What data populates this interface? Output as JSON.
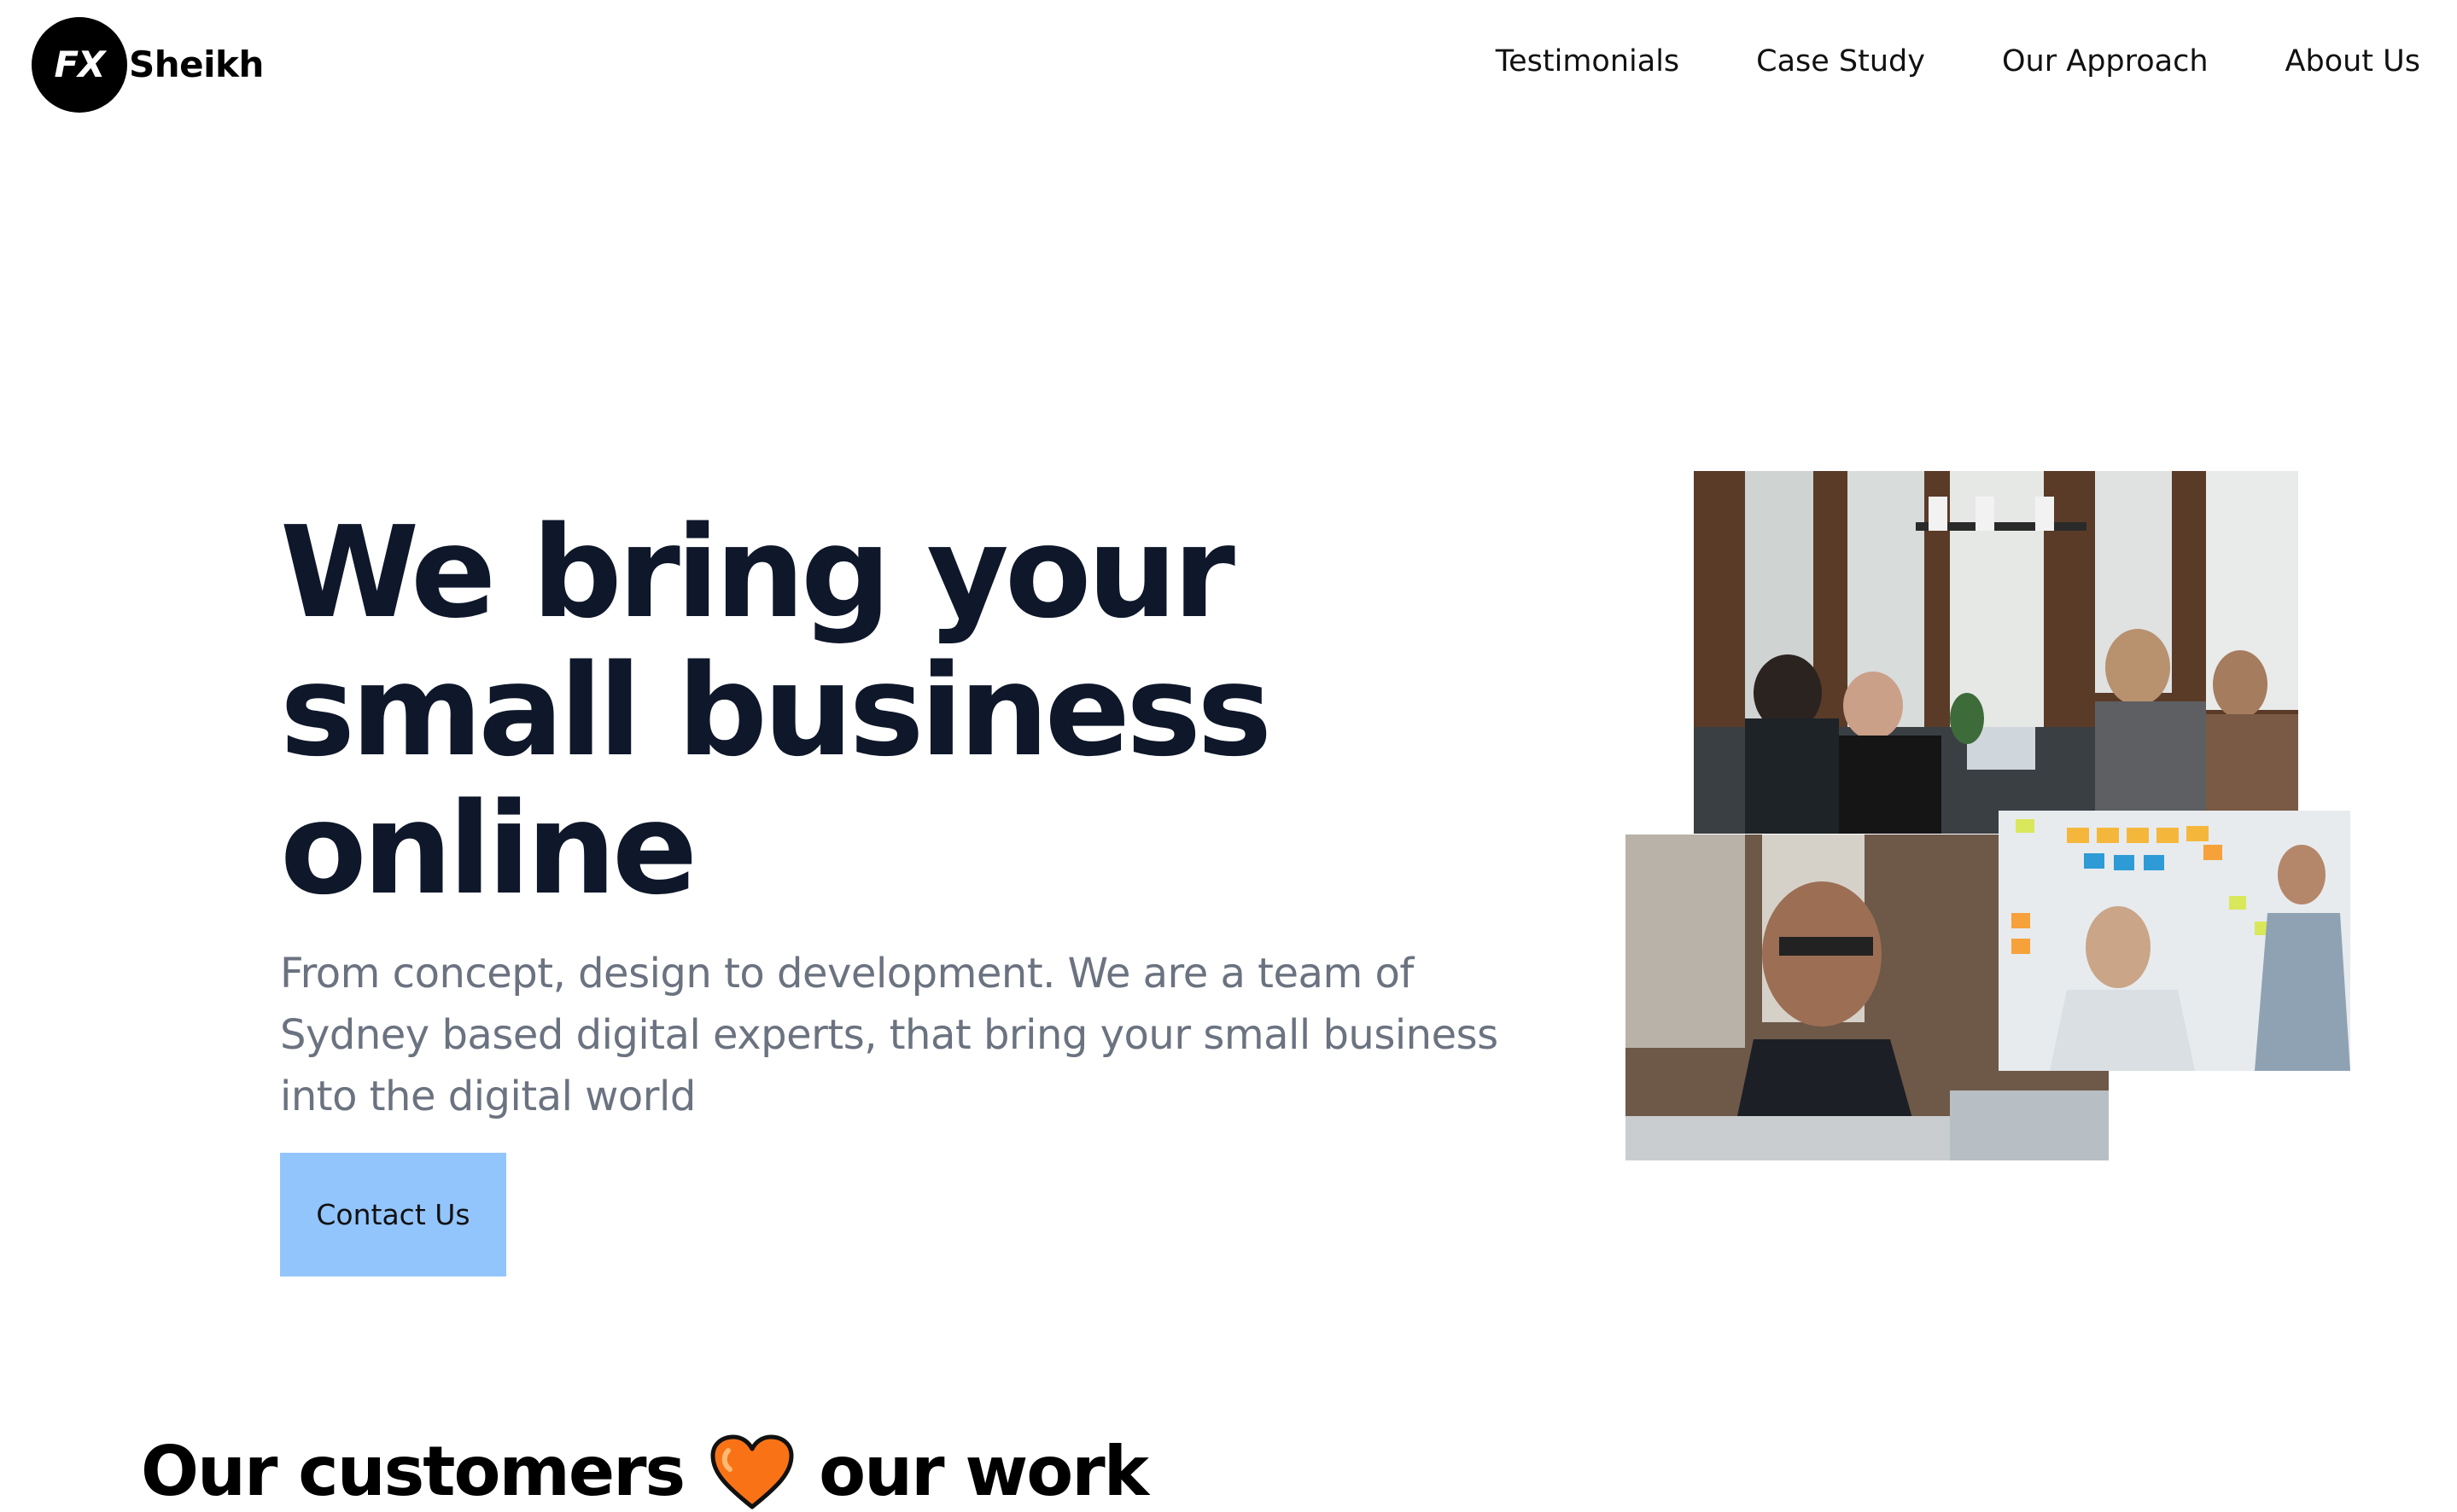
{
  "header": {
    "logo_badge": "FX",
    "logo_text": "Sheikh",
    "nav": [
      {
        "label": "Testimonials"
      },
      {
        "label": "Case Study"
      },
      {
        "label": "Our Approach"
      },
      {
        "label": "About Us"
      }
    ]
  },
  "hero": {
    "title_line1": "We bring your",
    "title_line2": "small business",
    "title_line3": "online",
    "subtitle": "From concept, design to development. We are a team of Sydney based digital experts, that bring your small business into the digital world",
    "cta_label": "Contact Us"
  },
  "images": {
    "meeting_alt": "Team meeting around a table",
    "developer_alt": "Developer with headphones at laptop",
    "whiteboard_alt": "People planning with sticky notes on a whiteboard"
  },
  "customers": {
    "heading_start": "Our customers",
    "heading_end": "our work",
    "heart_icon": "heart-icon"
  },
  "colors": {
    "text_dark": "#0f172a",
    "subtitle_gray": "#6b7280",
    "cta_blue": "#93c5fd",
    "heart_orange": "#f97316"
  }
}
